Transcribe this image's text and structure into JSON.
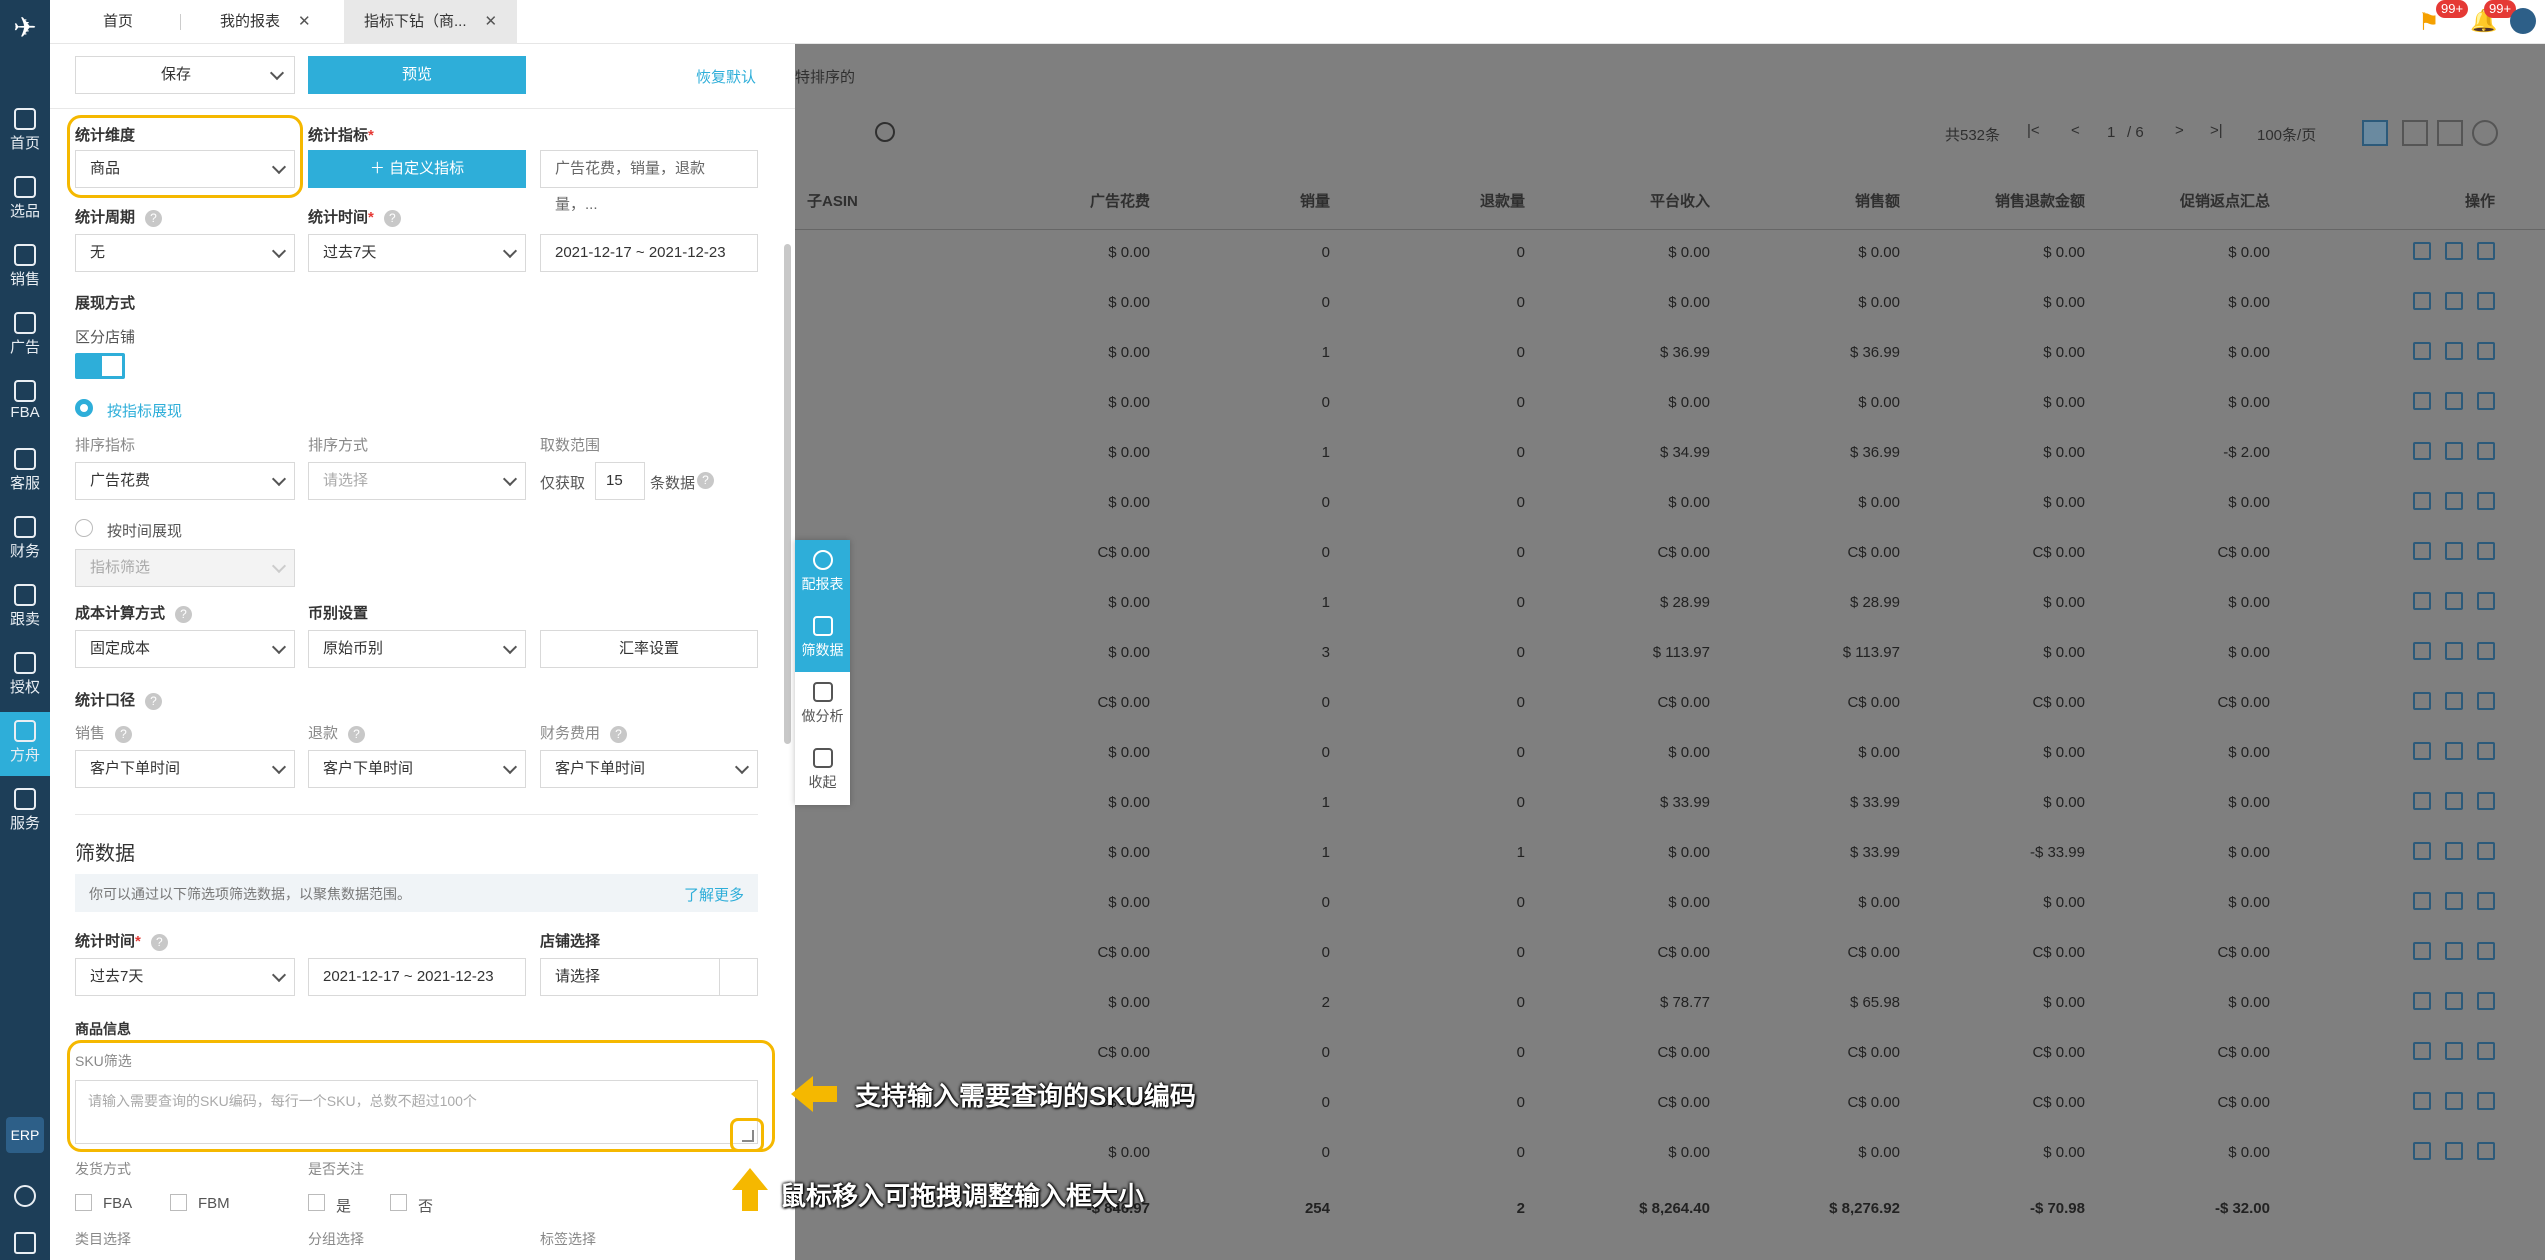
{
  "rail": {
    "items": [
      "首页",
      "选品",
      "销售",
      "广告",
      "FBA",
      "客服",
      "财务",
      "跟卖",
      "授权",
      "方舟",
      "服务"
    ],
    "erp": "ERP"
  },
  "tabs": [
    {
      "label": "首页"
    },
    {
      "label": "我的报表"
    },
    {
      "label": "指标下钻（商..."
    }
  ],
  "badges": [
    "99+",
    "99+"
  ],
  "panel": {
    "save_label": "保存",
    "preview_label": "预览",
    "reset_label": "恢复默认",
    "stat_dimension_label": "统计维度",
    "stat_dimension_value": "商品",
    "stat_metric_label": "统计指标",
    "custom_metric_label": "自定义指标",
    "metric_summary": "广告花费，销量，退款量，...",
    "stat_period_label": "统计周期",
    "stat_period_value": "无",
    "stat_time_label": "统计时间",
    "stat_time_value": "过去7天",
    "date_range": "2021-12-17  ~  2021-12-23",
    "display_mode_label": "展现方式",
    "split_store_label": "区分店铺",
    "by_metric_label": "按指标展现",
    "sort_metric_label": "排序指标",
    "sort_metric_value": "广告花费",
    "sort_order_label": "排序方式",
    "sort_order_placeholder": "请选择",
    "take_range_label": "取数范围",
    "take_only_label": "仅获取",
    "take_count": "15",
    "take_unit_label": "条数据",
    "by_time_label": "按时间展现",
    "metric_filter_placeholder": "指标筛选",
    "cost_method_label": "成本计算方式",
    "cost_method_value": "固定成本",
    "currency_label": "币别设置",
    "currency_value": "原始币别",
    "fx_button_label": "汇率设置",
    "stat_scope_label": "统计口径",
    "sales_label": "销售",
    "sales_value": "客户下单时间",
    "refund_label": "退款",
    "refund_value": "客户下单时间",
    "finance_label": "财务费用",
    "finance_value": "客户下单时间",
    "filter_section_title": "筛数据",
    "filter_hint": "你可以通过以下筛选项筛选数据，以聚焦数据范围。",
    "learn_more_label": "了解更多",
    "filter_time_label": "统计时间",
    "filter_time_value": "过去7天",
    "filter_date_range": "2021-12-17  ~  2021-12-23",
    "store_select_label": "店铺选择",
    "store_select_placeholder": "请选择",
    "product_info_label": "商品信息",
    "sku_filter_label": "SKU筛选",
    "sku_placeholder": "请输入需要查询的SKU编码，每行一个SKU，总数不超过100个",
    "ship_method_label": "发货方式",
    "fba_label": "FBA",
    "fbm_label": "FBM",
    "follow_label": "是否关注",
    "yes_label": "是",
    "no_label": "否",
    "category_label": "类目选择",
    "group_label": "分组选择",
    "tag_label": "标签选择"
  },
  "toolstrip": [
    "配报表",
    "筛数据",
    "做分析",
    "收起"
  ],
  "table": {
    "sort_hint": "特排序的",
    "total_label": "共532条",
    "page_current": "1",
    "page_total": "/ 6",
    "page_size": "100条/页",
    "operation_header": "操作",
    "columns": [
      "子ASIN",
      "广告花费",
      "销量",
      "退款量",
      "平台收入",
      "销售额",
      "销售退款金额",
      "促销返点汇总"
    ],
    "rows": [
      [
        "$ 0.00",
        "0",
        "0",
        "$ 0.00",
        "$ 0.00",
        "$ 0.00",
        "$ 0.00"
      ],
      [
        "$ 0.00",
        "0",
        "0",
        "$ 0.00",
        "$ 0.00",
        "$ 0.00",
        "$ 0.00"
      ],
      [
        "$ 0.00",
        "1",
        "0",
        "$ 36.99",
        "$ 36.99",
        "$ 0.00",
        "$ 0.00"
      ],
      [
        "$ 0.00",
        "0",
        "0",
        "$ 0.00",
        "$ 0.00",
        "$ 0.00",
        "$ 0.00"
      ],
      [
        "$ 0.00",
        "1",
        "0",
        "$ 34.99",
        "$ 36.99",
        "$ 0.00",
        "-$ 2.00"
      ],
      [
        "$ 0.00",
        "0",
        "0",
        "$ 0.00",
        "$ 0.00",
        "$ 0.00",
        "$ 0.00"
      ],
      [
        "C$ 0.00",
        "0",
        "0",
        "C$ 0.00",
        "C$ 0.00",
        "C$ 0.00",
        "C$ 0.00"
      ],
      [
        "$ 0.00",
        "1",
        "0",
        "$ 28.99",
        "$ 28.99",
        "$ 0.00",
        "$ 0.00"
      ],
      [
        "$ 0.00",
        "3",
        "0",
        "$ 113.97",
        "$ 113.97",
        "$ 0.00",
        "$ 0.00"
      ],
      [
        "C$ 0.00",
        "0",
        "0",
        "C$ 0.00",
        "C$ 0.00",
        "C$ 0.00",
        "C$ 0.00"
      ],
      [
        "$ 0.00",
        "0",
        "0",
        "$ 0.00",
        "$ 0.00",
        "$ 0.00",
        "$ 0.00"
      ],
      [
        "$ 0.00",
        "1",
        "0",
        "$ 33.99",
        "$ 33.99",
        "$ 0.00",
        "$ 0.00"
      ],
      [
        "$ 0.00",
        "1",
        "1",
        "$ 0.00",
        "$ 33.99",
        "-$ 33.99",
        "$ 0.00"
      ],
      [
        "$ 0.00",
        "0",
        "0",
        "$ 0.00",
        "$ 0.00",
        "$ 0.00",
        "$ 0.00"
      ],
      [
        "C$ 0.00",
        "0",
        "0",
        "C$ 0.00",
        "C$ 0.00",
        "C$ 0.00",
        "C$ 0.00"
      ],
      [
        "$ 0.00",
        "2",
        "0",
        "$ 78.77",
        "$ 65.98",
        "$ 0.00",
        "$ 0.00"
      ],
      [
        "C$ 0.00",
        "0",
        "0",
        "C$ 0.00",
        "C$ 0.00",
        "C$ 0.00",
        "C$ 0.00"
      ],
      [
        "C$ 0.00",
        "0",
        "0",
        "C$ 0.00",
        "C$ 0.00",
        "C$ 0.00",
        "C$ 0.00"
      ],
      [
        "$ 0.00",
        "0",
        "0",
        "$ 0.00",
        "$ 0.00",
        "$ 0.00",
        "$ 0.00"
      ]
    ],
    "totals": [
      "-$ 846.97",
      "254",
      "2",
      "$ 8,264.40",
      "$ 8,276.92",
      "-$ 70.98",
      "-$ 32.00"
    ]
  },
  "annotations": {
    "sku_hint": "支持输入需要查询的SKU编码",
    "resize_hint": "鼠标移入可拖拽调整输入框大小"
  },
  "colors": {
    "accent": "#2eaed9",
    "rail": "#1d3e58",
    "highlight": "#f5b800"
  }
}
